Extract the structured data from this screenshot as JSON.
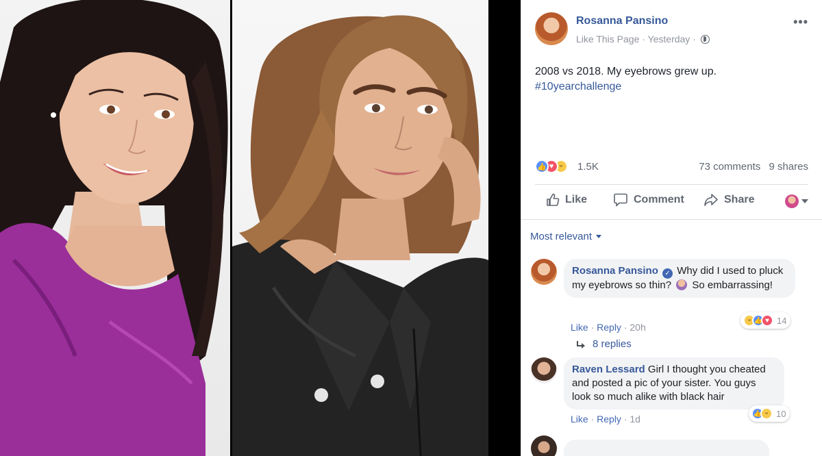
{
  "post": {
    "page_name": "Rosanna Pansino",
    "like_page": "Like This Page",
    "time": "Yesterday",
    "text": "2008 vs 2018. My eyebrows grew up.",
    "hashtag": "#10yearchallenge",
    "reaction_count": "1.5K",
    "comments_count": "73 comments",
    "shares_count": "9 shares"
  },
  "actions": {
    "like": "Like",
    "comment": "Comment",
    "share": "Share"
  },
  "sort": {
    "label": "Most relevant"
  },
  "comments": [
    {
      "author": "Rosanna Pansino",
      "text_a": "Why did I used to pluck my eyebrows so thin?",
      "text_b": "So embarrassing!",
      "like": "Like",
      "reply": "Reply",
      "time": "20h",
      "reactions": "14",
      "replies": "8 replies"
    },
    {
      "author": "Raven Lessard",
      "text": "Girl I thought you cheated and posted a pic of your sister. You guys look so much alike with black hair",
      "like": "Like",
      "reply": "Reply",
      "time": "1d",
      "reactions": "10"
    }
  ],
  "colors": {
    "link_blue": "#365899",
    "fb_blue": "#4267b2",
    "meta_gray": "#90949c",
    "bubble_gray": "#f2f3f5"
  },
  "icons": [
    "globe-icon",
    "more-icon",
    "like-reaction-icon",
    "love-reaction-icon",
    "haha-reaction-icon",
    "thumbs-up-icon",
    "comment-icon",
    "share-icon",
    "caret-down-icon",
    "verified-icon",
    "reply-arrow-icon"
  ]
}
